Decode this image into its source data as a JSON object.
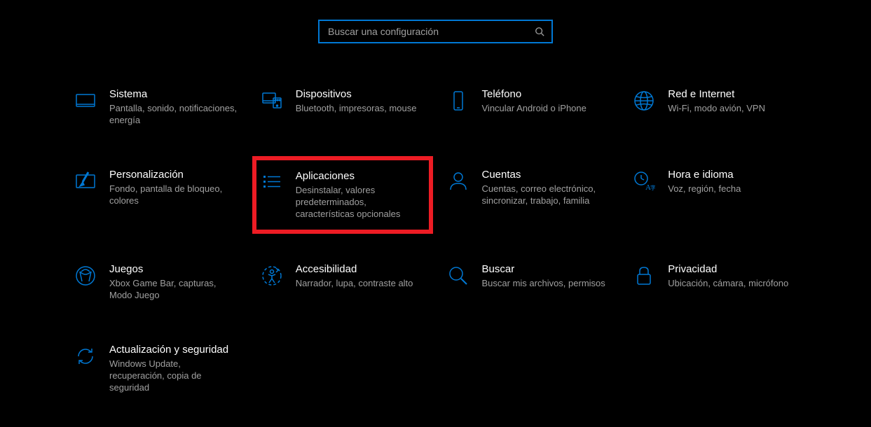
{
  "search": {
    "placeholder": "Buscar una configuración"
  },
  "categories": [
    {
      "title": "Sistema",
      "desc": "Pantalla, sonido, notificaciones, energía"
    },
    {
      "title": "Dispositivos",
      "desc": "Bluetooth, impresoras, mouse"
    },
    {
      "title": "Teléfono",
      "desc": "Vincular Android o iPhone"
    },
    {
      "title": "Red e Internet",
      "desc": "Wi-Fi, modo avión, VPN"
    },
    {
      "title": "Personalización",
      "desc": "Fondo, pantalla de bloqueo, colores"
    },
    {
      "title": "Aplicaciones",
      "desc": "Desinstalar, valores predeterminados, características opcionales"
    },
    {
      "title": "Cuentas",
      "desc": "Cuentas, correo electrónico, sincronizar, trabajo, familia"
    },
    {
      "title": "Hora e idioma",
      "desc": "Voz, región, fecha"
    },
    {
      "title": "Juegos",
      "desc": "Xbox Game Bar, capturas, Modo Juego"
    },
    {
      "title": "Accesibilidad",
      "desc": "Narrador, lupa, contraste alto"
    },
    {
      "title": "Buscar",
      "desc": "Buscar mis archivos, permisos"
    },
    {
      "title": "Privacidad",
      "desc": "Ubicación, cámara, micrófono"
    },
    {
      "title": "Actualización y seguridad",
      "desc": "Windows Update, recuperación, copia de seguridad"
    }
  ]
}
